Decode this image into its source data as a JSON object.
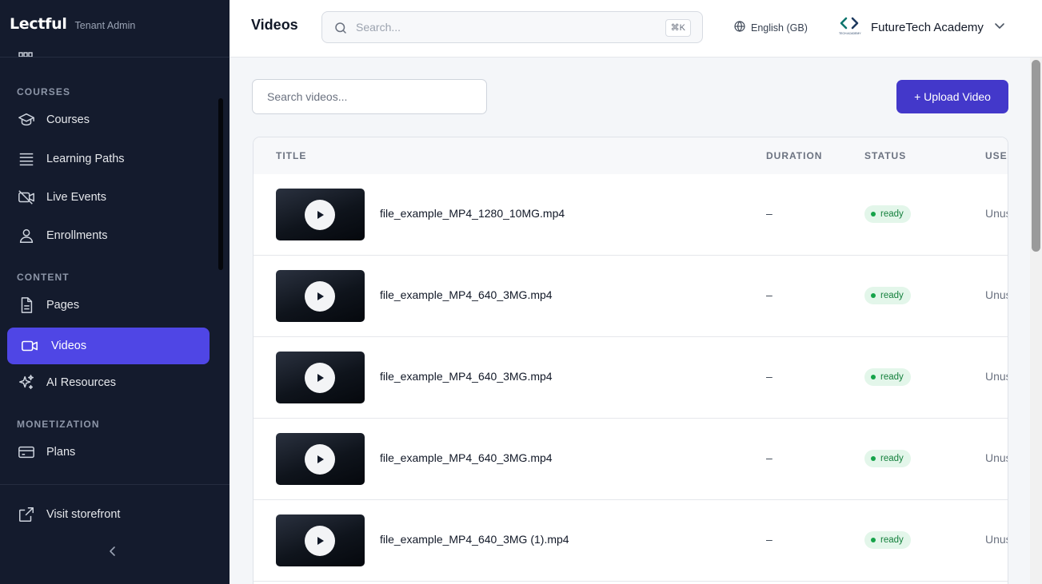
{
  "brand": {
    "name": "Lectful",
    "subtitle": "Tenant Admin"
  },
  "sidebar": {
    "sections": [
      {
        "label": "COURSES",
        "items": [
          {
            "label": "Courses",
            "icon": "graduation-cap-icon"
          },
          {
            "label": "Learning Paths",
            "icon": "layers-icon"
          },
          {
            "label": "Live Events",
            "icon": "video-off-icon"
          },
          {
            "label": "Enrollments",
            "icon": "user-icon"
          }
        ]
      },
      {
        "label": "CONTENT",
        "items": [
          {
            "label": "Pages",
            "icon": "file-text-icon"
          },
          {
            "label": "Videos",
            "icon": "video-icon",
            "active": true
          },
          {
            "label": "AI Resources",
            "icon": "sparkles-icon"
          }
        ]
      },
      {
        "label": "MONETIZATION",
        "items": [
          {
            "label": "Plans",
            "icon": "credit-card-icon"
          }
        ]
      }
    ],
    "footer": {
      "visit_label": "Visit storefront"
    }
  },
  "header": {
    "title": "Videos",
    "search_placeholder": "Search...",
    "search_shortcut": "⌘K",
    "language": "English (GB)",
    "org_name": "FutureTech Academy",
    "org_logo_text": "TECH ACADEMY"
  },
  "main": {
    "video_search_placeholder": "Search videos...",
    "upload_label": "+ Upload Video",
    "columns": [
      "TITLE",
      "DURATION",
      "STATUS",
      "USED IN"
    ],
    "rows": [
      {
        "title": "file_example_MP4_1280_10MG.mp4",
        "duration": "–",
        "status": "ready",
        "usage": "Unused"
      },
      {
        "title": "file_example_MP4_640_3MG.mp4",
        "duration": "–",
        "status": "ready",
        "usage": "Unused"
      },
      {
        "title": "file_example_MP4_640_3MG.mp4",
        "duration": "–",
        "status": "ready",
        "usage": "Unused"
      },
      {
        "title": "file_example_MP4_640_3MG.mp4",
        "duration": "–",
        "status": "ready",
        "usage": "Unused"
      },
      {
        "title": "file_example_MP4_640_3MG (1).mp4",
        "duration": "–",
        "status": "ready",
        "usage": "Unused"
      }
    ]
  },
  "colors": {
    "sidebar_bg": "#141b2d",
    "accent": "#4f46e5",
    "upload_button": "#4338ca",
    "status_ready_bg": "#e3f6ea",
    "status_ready_text": "#15803d"
  }
}
